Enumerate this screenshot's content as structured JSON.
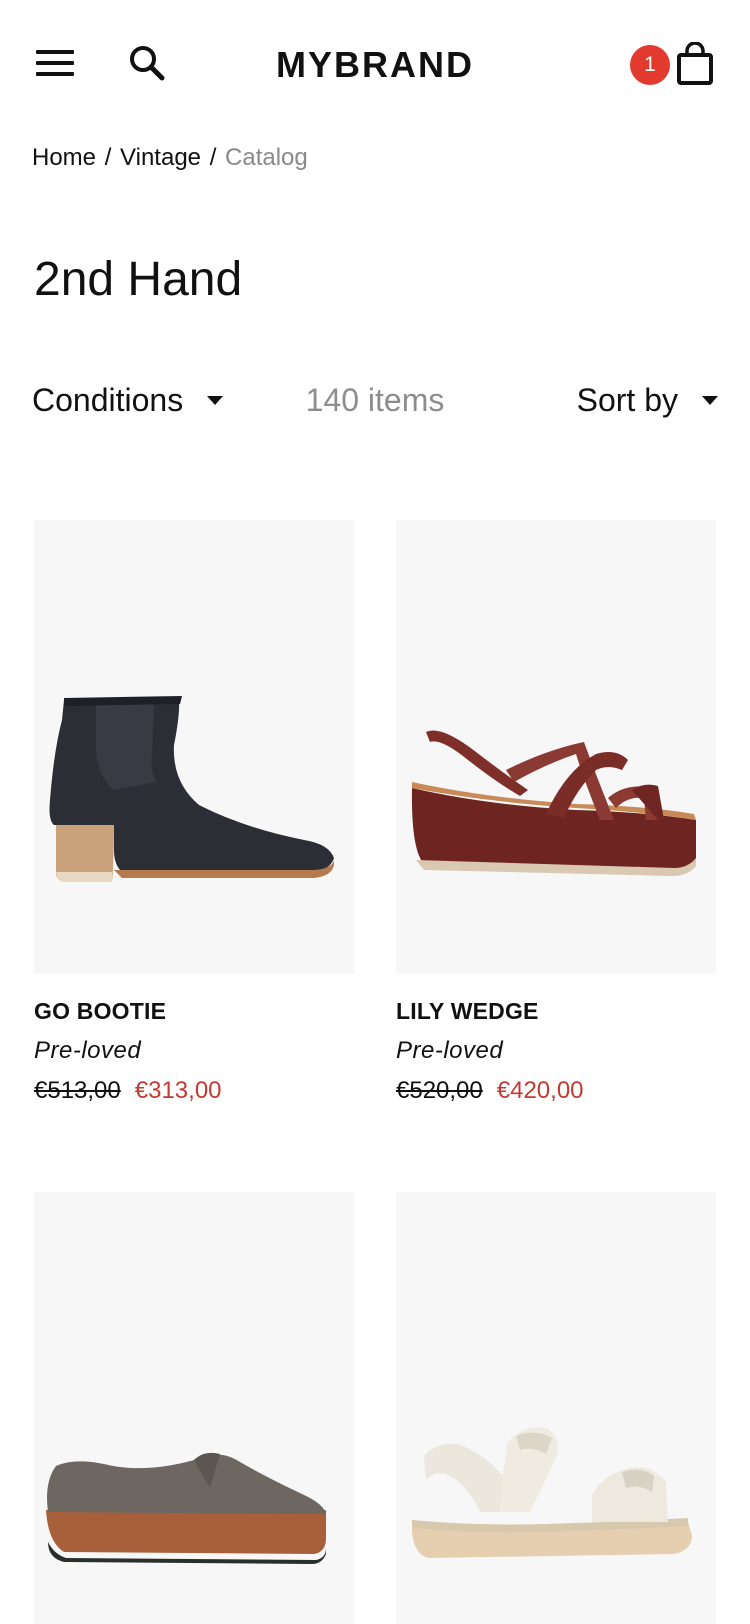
{
  "header": {
    "brand": "MYBRAND",
    "cart_count": "1",
    "icons": {
      "menu": "hamburger-menu-icon",
      "search": "search-icon",
      "cart": "shopping-bag-icon"
    }
  },
  "breadcrumb": {
    "items": [
      "Home",
      "Vintage"
    ],
    "current": "Catalog",
    "separator": "/"
  },
  "page": {
    "title": "2nd Hand"
  },
  "toolbar": {
    "conditions_label": "Conditions",
    "item_count": "140 items",
    "sort_label": "Sort by"
  },
  "colors": {
    "sale_price": "#c13b32",
    "badge": "#e23a2e",
    "muted_text": "#8d8d8d",
    "image_bg": "#f7f7f7"
  },
  "products": [
    {
      "name": "GO BOOTIE",
      "condition": "Pre-loved",
      "old_price": "€513,00",
      "new_price": "€313,00",
      "image": "black-ankle-boot"
    },
    {
      "name": "LILY WEDGE",
      "condition": "Pre-loved",
      "old_price": "€520,00",
      "new_price": "€420,00",
      "image": "burgundy-wedge-sandal"
    },
    {
      "name": "",
      "condition": "",
      "old_price": "",
      "new_price": "",
      "image": "grey-platform-loafer"
    },
    {
      "name": "",
      "condition": "",
      "old_price": "",
      "new_price": "",
      "image": "white-strap-sandal"
    }
  ]
}
